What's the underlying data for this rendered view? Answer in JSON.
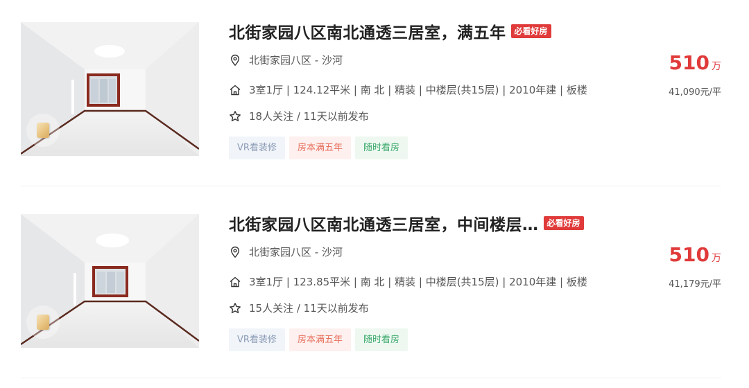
{
  "listings": [
    {
      "title": "北街家园八区南北通透三居室，满五年",
      "badge": "必看好房",
      "community": "北街家园八区",
      "separator": " - ",
      "district": "沙河",
      "house_info": "3室1厅 | 124.12平米 | 南 北 | 精装 | 中楼层(共15层) | 2010年建 | 板楼",
      "follow_info": "18人关注 / 11天以前发布",
      "tags": [
        "VR看装修",
        "房本满五年",
        "随时看房"
      ],
      "total_price": "510",
      "price_unit": "万",
      "unit_price": "41,090元/平"
    },
    {
      "title": "北街家园八区南北通透三居室，中间楼层…",
      "badge": "必看好房",
      "community": "北街家园八区",
      "separator": " - ",
      "district": "沙河",
      "house_info": "3室1厅 | 123.85平米 | 南 北 | 精装 | 中楼层(共15层) | 2010年建 | 板楼",
      "follow_info": "15人关注 / 11天以前发布",
      "tags": [
        "VR看装修",
        "房本满五年",
        "随时看房"
      ],
      "total_price": "510",
      "price_unit": "万",
      "unit_price": "41,179元/平"
    }
  ],
  "icons": {
    "location": "location-pin-icon",
    "house": "house-icon",
    "follow": "star-icon",
    "vr": "vr-cube-icon"
  },
  "colors": {
    "accent_red": "#e03a3a",
    "tag_vr_text": "#8b9bb5",
    "tag_five_text": "#e8705d",
    "tag_anytime_text": "#3eaa6d"
  }
}
